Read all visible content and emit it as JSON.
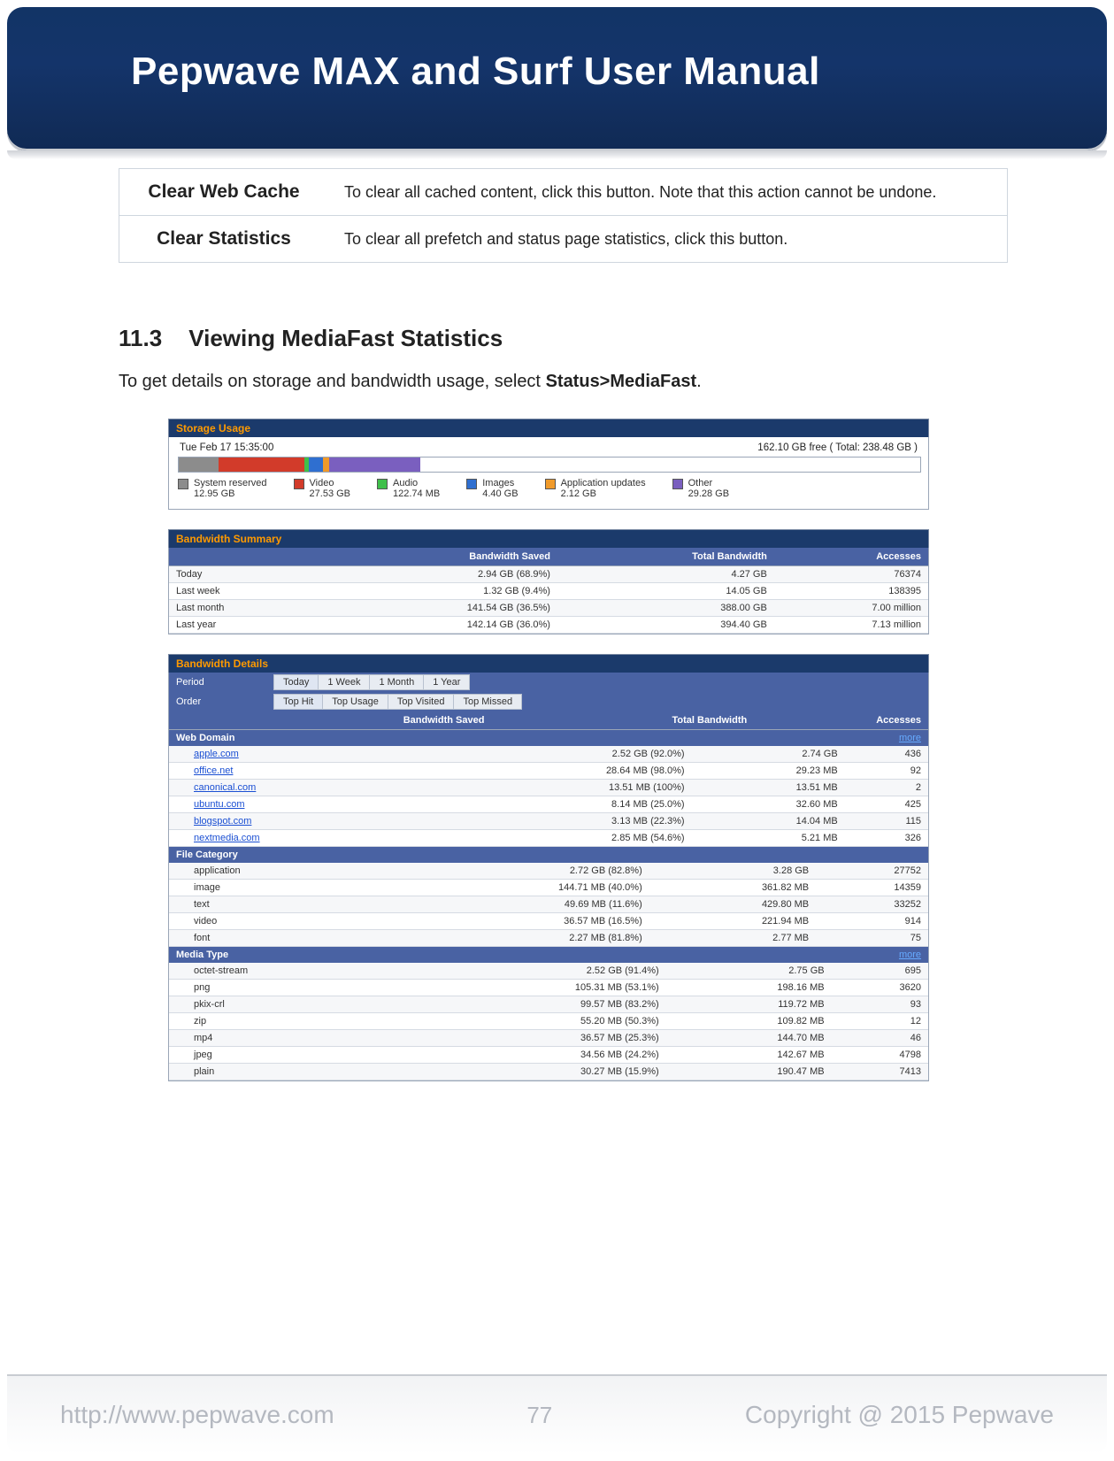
{
  "header": {
    "title": "Pepwave MAX and Surf User Manual"
  },
  "footer": {
    "left": "http://www.pepwave.com",
    "mid": "77",
    "right": "Copyright @ 2015 Pepwave"
  },
  "def_rows": [
    {
      "k": "Clear Web Cache",
      "v": "To clear all cached content, click this button. Note that this action cannot be undone."
    },
    {
      "k": "Clear Statistics",
      "v": "To clear all prefetch and status page statistics, click this button."
    }
  ],
  "section": {
    "num": "11.3",
    "title": "Viewing MediaFast Statistics"
  },
  "body_text": {
    "pre": "To get details on storage and bandwidth usage, select ",
    "bold": "Status>MediaFast",
    "post": "."
  },
  "storage": {
    "panel": "Storage Usage",
    "ts": "Tue Feb 17 15:35:00",
    "free": "162.10 GB free ( Total: 238.48 GB )",
    "legend": [
      {
        "name": "System reserved",
        "value": "12.95 GB",
        "color": "#8c8c8c"
      },
      {
        "name": "Video",
        "value": "27.53 GB",
        "color": "#d23b2a"
      },
      {
        "name": "Audio",
        "value": "122.74 MB",
        "color": "#3fbf4a"
      },
      {
        "name": "Images",
        "value": "4.40 GB",
        "color": "#2f6fd0"
      },
      {
        "name": "Application updates",
        "value": "2.12 GB",
        "color": "#f09a2a"
      },
      {
        "name": "Other",
        "value": "29.28 GB",
        "color": "#7a5fbf"
      }
    ],
    "segments": [
      {
        "color": "#8c8c8c",
        "w": 5.4
      },
      {
        "color": "#d23b2a",
        "w": 11.5
      },
      {
        "color": "#3fbf4a",
        "w": 0.6
      },
      {
        "color": "#2f6fd0",
        "w": 1.9
      },
      {
        "color": "#f09a2a",
        "w": 0.9
      },
      {
        "color": "#7a5fbf",
        "w": 12.3
      },
      {
        "color": "#ffffff",
        "w": 67.4
      }
    ]
  },
  "summary": {
    "panel": "Bandwidth Summary",
    "headers": [
      "",
      "Bandwidth Saved",
      "Total Bandwidth",
      "Accesses"
    ],
    "rows": [
      [
        "Today",
        "2.94 GB (68.9%)",
        "4.27 GB",
        "76374"
      ],
      [
        "Last week",
        "1.32 GB (9.4%)",
        "14.05 GB",
        "138395"
      ],
      [
        "Last month",
        "141.54 GB (36.5%)",
        "388.00 GB",
        "7.00 million"
      ],
      [
        "Last year",
        "142.14 GB (36.0%)",
        "394.40 GB",
        "7.13 million"
      ]
    ]
  },
  "details": {
    "panel": "Bandwidth Details",
    "period": {
      "label": "Period",
      "tabs": [
        "Today",
        "1 Week",
        "1 Month",
        "1 Year"
      ],
      "active": 0
    },
    "order": {
      "label": "Order",
      "tabs": [
        "Top Hit",
        "Top Usage",
        "Top Visited",
        "Top Missed"
      ],
      "active": 0
    },
    "headers": [
      "",
      "Bandwidth Saved",
      "Total Bandwidth",
      "Accesses"
    ],
    "groups": [
      {
        "title": "Web Domain",
        "more": true,
        "link": true,
        "rows": [
          [
            "apple.com",
            "2.52 GB (92.0%)",
            "2.74 GB",
            "436"
          ],
          [
            "office.net",
            "28.64 MB (98.0%)",
            "29.23 MB",
            "92"
          ],
          [
            "canonical.com",
            "13.51 MB (100%)",
            "13.51 MB",
            "2"
          ],
          [
            "ubuntu.com",
            "8.14 MB (25.0%)",
            "32.60 MB",
            "425"
          ],
          [
            "blogspot.com",
            "3.13 MB (22.3%)",
            "14.04 MB",
            "115"
          ],
          [
            "nextmedia.com",
            "2.85 MB (54.6%)",
            "5.21 MB",
            "326"
          ]
        ]
      },
      {
        "title": "File Category",
        "more": false,
        "link": false,
        "rows": [
          [
            "application",
            "2.72 GB (82.8%)",
            "3.28 GB",
            "27752"
          ],
          [
            "image",
            "144.71 MB (40.0%)",
            "361.82 MB",
            "14359"
          ],
          [
            "text",
            "49.69 MB (11.6%)",
            "429.80 MB",
            "33252"
          ],
          [
            "video",
            "36.57 MB (16.5%)",
            "221.94 MB",
            "914"
          ],
          [
            "font",
            "2.27 MB (81.8%)",
            "2.77 MB",
            "75"
          ]
        ]
      },
      {
        "title": "Media Type",
        "more": true,
        "link": false,
        "rows": [
          [
            "octet-stream",
            "2.52 GB (91.4%)",
            "2.75 GB",
            "695"
          ],
          [
            "png",
            "105.31 MB (53.1%)",
            "198.16 MB",
            "3620"
          ],
          [
            "pkix-crl",
            "99.57 MB (83.2%)",
            "119.72 MB",
            "93"
          ],
          [
            "zip",
            "55.20 MB (50.3%)",
            "109.82 MB",
            "12"
          ],
          [
            "mp4",
            "36.57 MB (25.3%)",
            "144.70 MB",
            "46"
          ],
          [
            "jpeg",
            "34.56 MB (24.2%)",
            "142.67 MB",
            "4798"
          ],
          [
            "plain",
            "30.27 MB (15.9%)",
            "190.47 MB",
            "7413"
          ]
        ]
      }
    ]
  },
  "chart_data": {
    "type": "bar",
    "title": "Storage Usage",
    "categories": [
      "System reserved",
      "Video",
      "Audio",
      "Images",
      "Application updates",
      "Other",
      "Free"
    ],
    "values_gb": [
      12.95,
      27.53,
      0.12,
      4.4,
      2.12,
      29.28,
      162.1
    ],
    "total_gb": 238.48,
    "timestamp": "Tue Feb 17 15:35:00",
    "colors": [
      "#8c8c8c",
      "#d23b2a",
      "#3fbf4a",
      "#2f6fd0",
      "#f09a2a",
      "#7a5fbf",
      "#ffffff"
    ]
  }
}
